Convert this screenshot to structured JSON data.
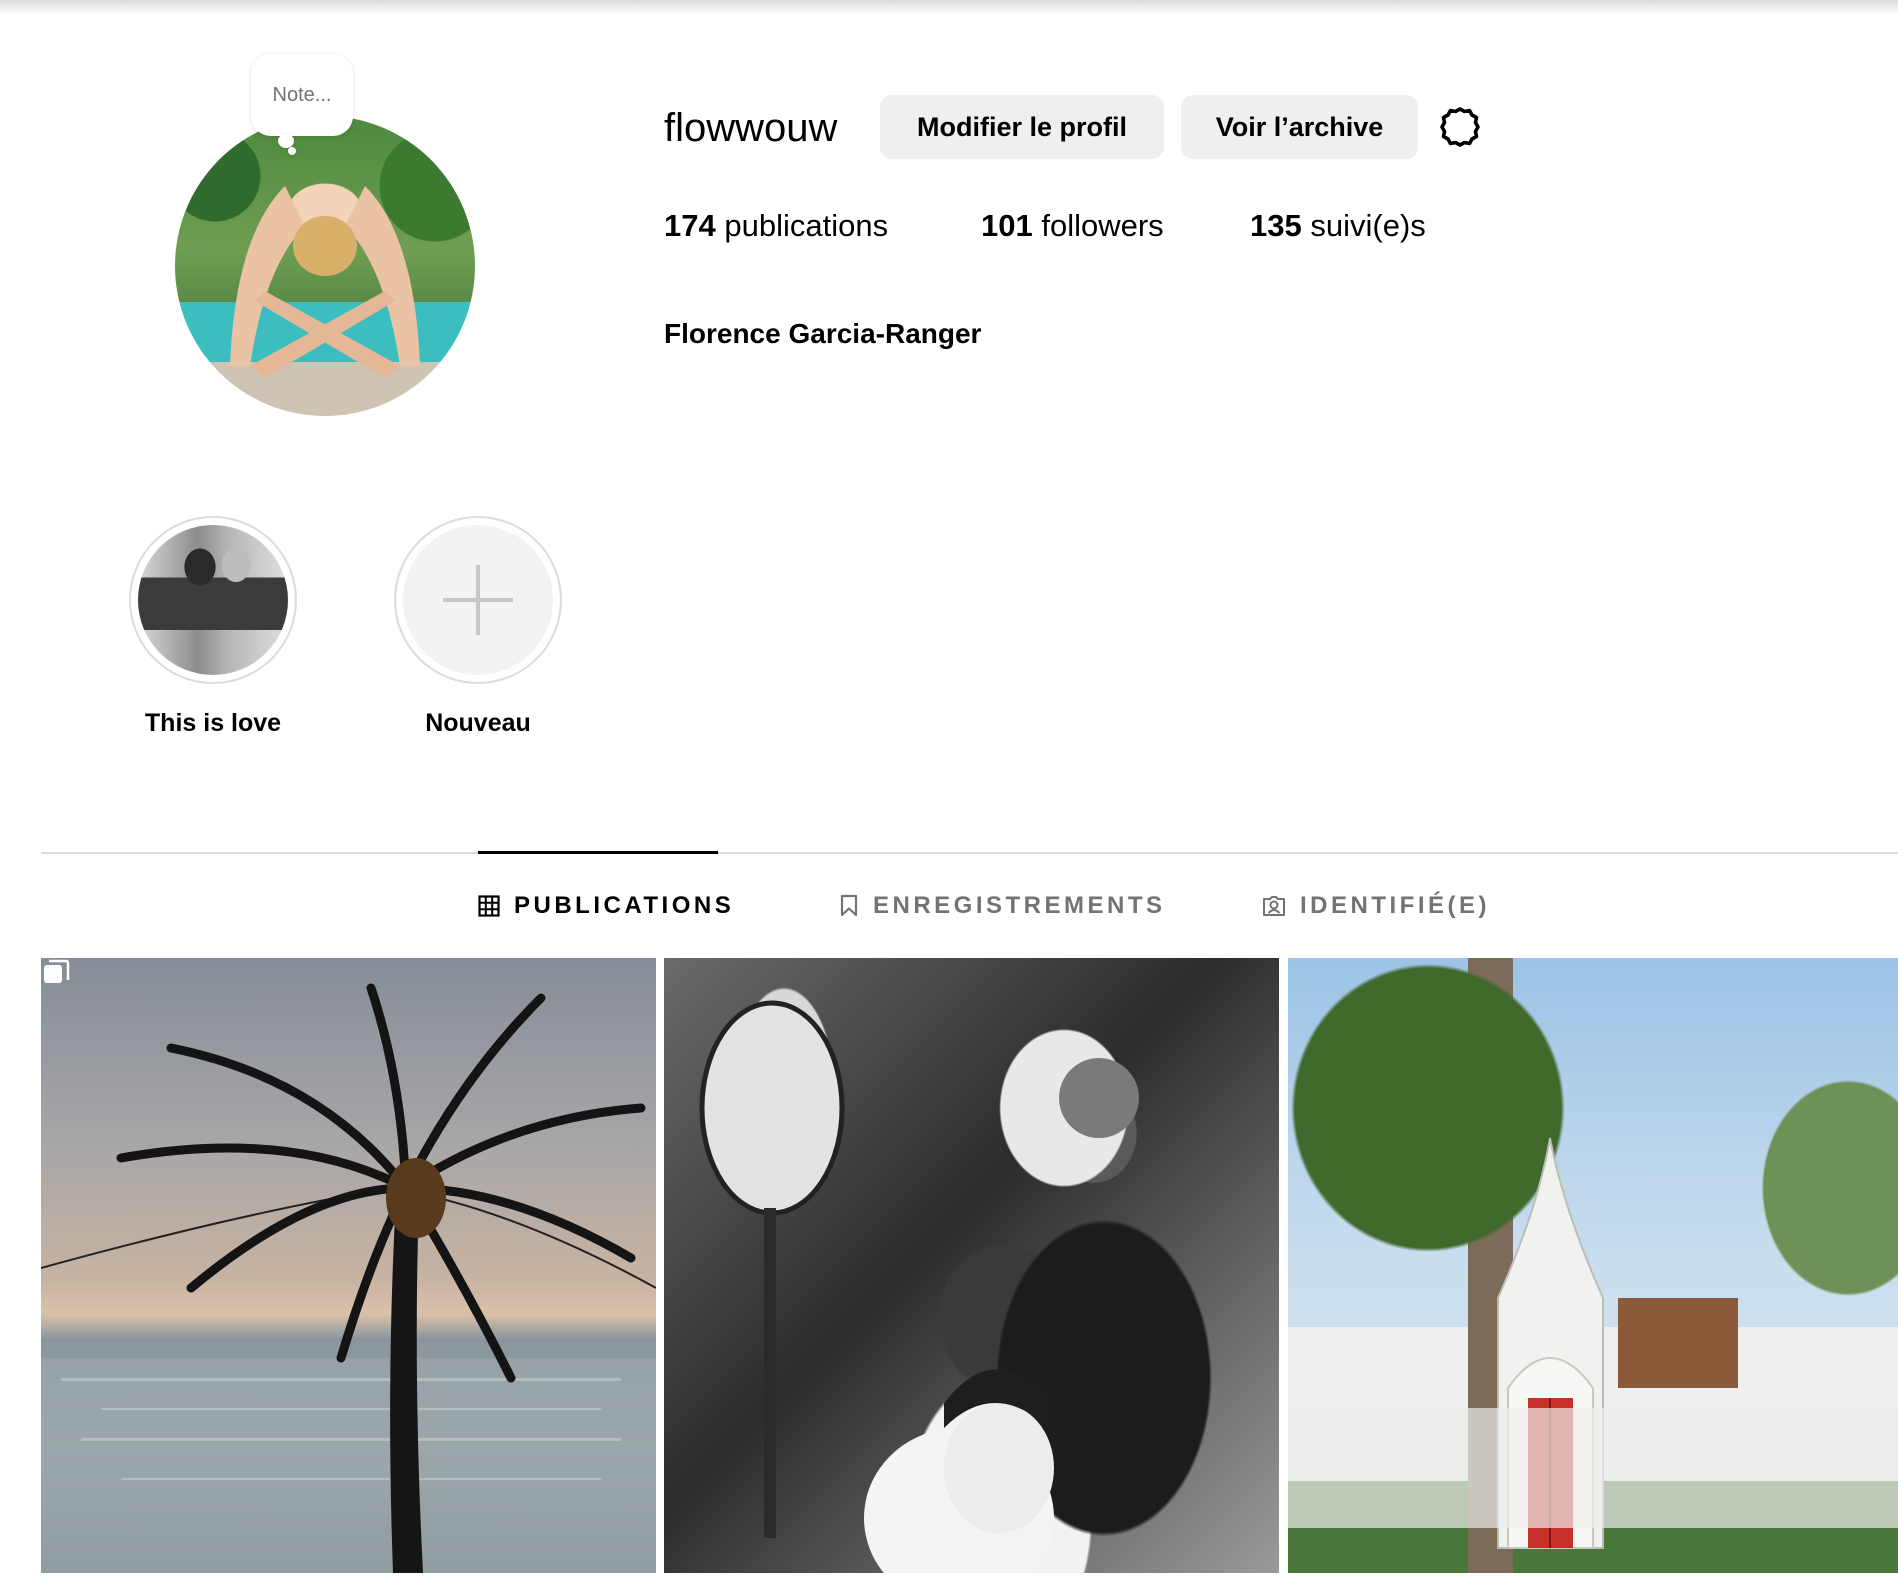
{
  "profile": {
    "note_placeholder": "Note...",
    "username": "flowwouw",
    "edit_button": "Modifier le profil",
    "archive_button": "Voir l’archive",
    "settings_icon": "settings-gear-icon",
    "stats": {
      "posts_count": "174",
      "posts_label": "publications",
      "followers_count": "101",
      "followers_label": "followers",
      "following_count": "135",
      "following_label": "suivi(e)s"
    },
    "full_name": "Florence Garcia-Ranger"
  },
  "highlights": [
    {
      "label": "This is love"
    },
    {
      "label": "Nouveau"
    }
  ],
  "tabs": [
    {
      "label": "PUBLICATIONS",
      "icon": "grid-icon",
      "active": true
    },
    {
      "label": "ENREGISTREMENTS",
      "icon": "bookmark-icon",
      "active": false
    },
    {
      "label": "IDENTIFIÉ(E)",
      "icon": "tagged-user-icon",
      "active": false
    }
  ],
  "posts": [
    {
      "description": "palm tree silhouette over sea",
      "multiple": true
    },
    {
      "description": "black and white monk and woman praying",
      "multiple": false
    },
    {
      "description": "white temple gate with red door",
      "multiple": false
    }
  ],
  "colors": {
    "button_bg": "#efefef",
    "divider": "#dbdbdb",
    "inactive_tab": "#737373"
  }
}
